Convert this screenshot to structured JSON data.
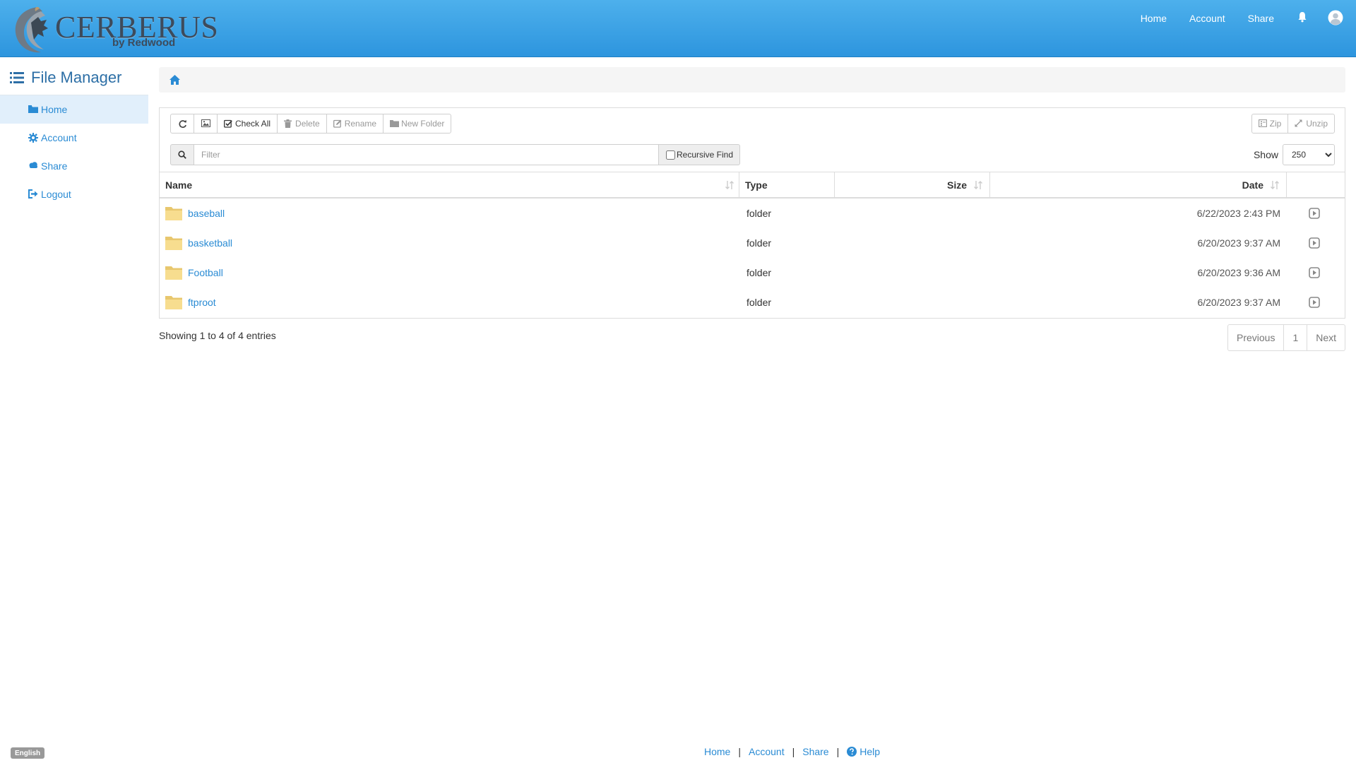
{
  "brand": {
    "name": "CERBERUS",
    "tagline": "by Redwood"
  },
  "topnav": {
    "home": "Home",
    "account": "Account",
    "share": "Share"
  },
  "sidebar": {
    "title": "File Manager",
    "items": [
      {
        "label": "Home",
        "icon": "folder-icon",
        "active": true
      },
      {
        "label": "Account",
        "icon": "gear-icon"
      },
      {
        "label": "Share",
        "icon": "cloud-icon"
      },
      {
        "label": "Logout",
        "icon": "logout-icon"
      }
    ]
  },
  "toolbar": {
    "check_all": "Check All",
    "delete": "Delete",
    "rename": "Rename",
    "new_folder": "New Folder",
    "zip": "Zip",
    "unzip": "Unzip"
  },
  "filter": {
    "placeholder": "Filter",
    "recursive_label": "Recursive Find"
  },
  "show": {
    "label": "Show",
    "value": "250"
  },
  "table": {
    "headers": {
      "name": "Name",
      "type": "Type",
      "size": "Size",
      "date": "Date"
    },
    "rows": [
      {
        "name": "baseball",
        "type": "folder",
        "size": "",
        "date": "6/22/2023 2:43 PM"
      },
      {
        "name": "basketball",
        "type": "folder",
        "size": "",
        "date": "6/20/2023 9:37 AM"
      },
      {
        "name": "Football",
        "type": "folder",
        "size": "",
        "date": "6/20/2023 9:36 AM"
      },
      {
        "name": "ftproot",
        "type": "folder",
        "size": "",
        "date": "6/20/2023 9:37 AM"
      }
    ]
  },
  "info": "Showing 1 to 4 of 4 entries",
  "pagination": {
    "previous": "Previous",
    "page": "1",
    "next": "Next"
  },
  "footer": {
    "home": "Home",
    "account": "Account",
    "share": "Share",
    "help": "Help",
    "separator": "|"
  },
  "language": "English",
  "colors": {
    "header": "#3aa3e6",
    "link": "#2a8bd4",
    "active_bg": "#e1effb"
  }
}
